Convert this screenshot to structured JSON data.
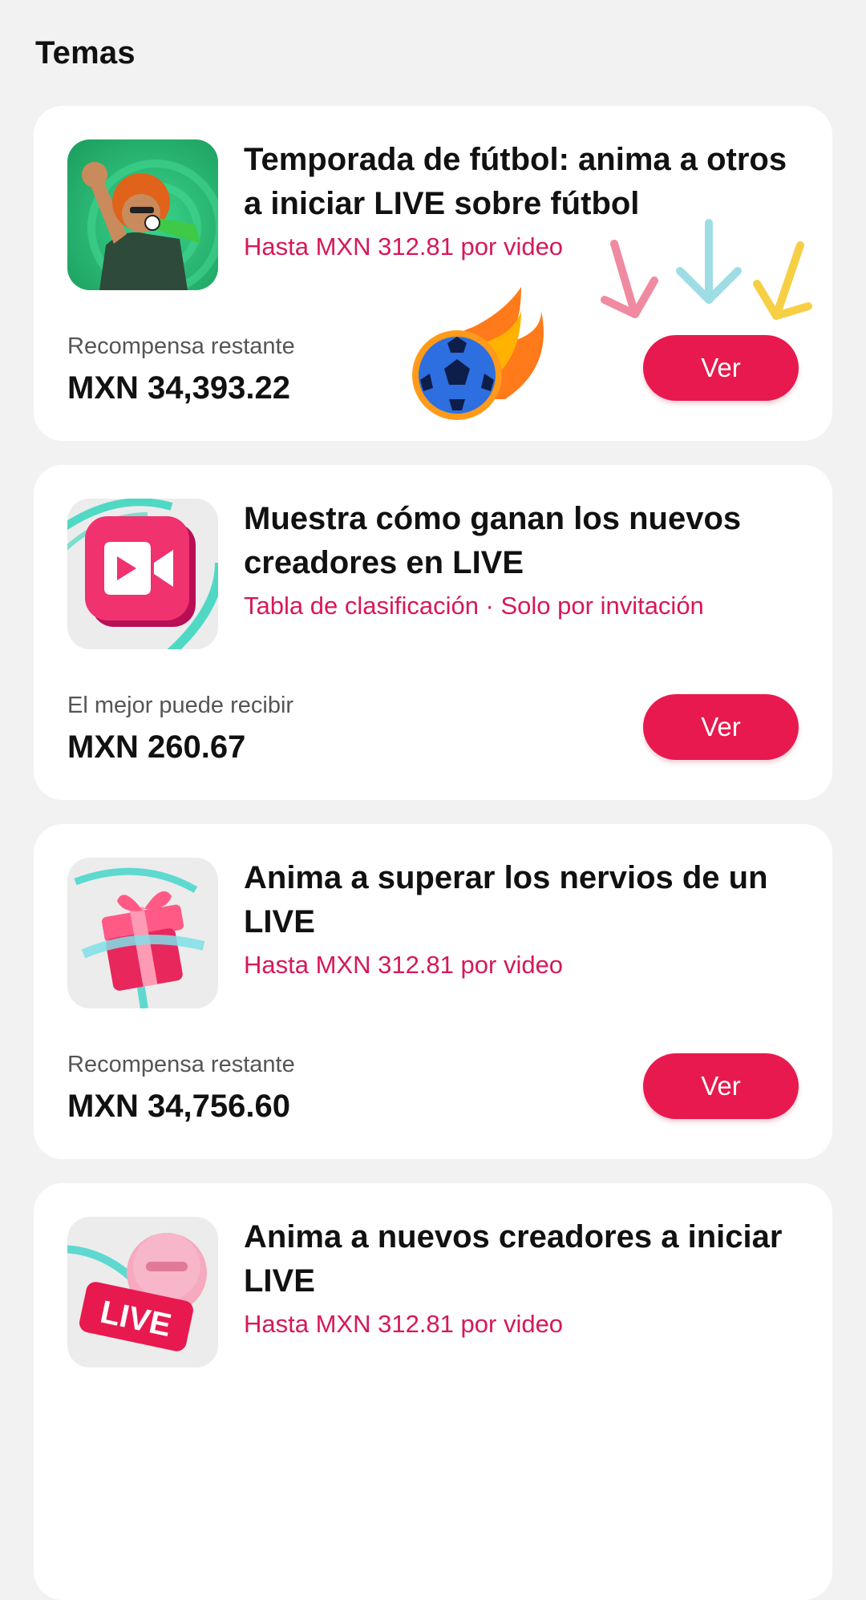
{
  "header": {
    "title": "Temas"
  },
  "cards": [
    {
      "title": "Temporada de fútbol: anima a otros a iniciar LIVE sobre fútbol",
      "subtitle": "Hasta MXN 312.81 por video",
      "reward_label": "Recompensa restante",
      "reward_value": "MXN 34,393.22",
      "button_label": "Ver",
      "icon": "football-fan-icon"
    },
    {
      "title": "Muestra cómo ganan los nuevos creadores en LIVE",
      "subtitle": "Tabla de clasificación · Solo por invitación",
      "reward_label": "El mejor puede recibir",
      "reward_value": "MXN 260.67",
      "button_label": "Ver",
      "icon": "video-camera-icon"
    },
    {
      "title": "Anima a superar los nervios de un LIVE",
      "subtitle": "Hasta MXN 312.81 por video",
      "reward_label": "Recompensa restante",
      "reward_value": "MXN 34,756.60",
      "button_label": "Ver",
      "icon": "gift-box-icon"
    },
    {
      "title": "Anima a nuevos creadores a iniciar LIVE",
      "subtitle": "Hasta MXN 312.81 por video",
      "icon": "live-badge-icon",
      "badge_text": "LIVE"
    }
  ],
  "decorations": {
    "sticker": "flaming-soccer-ball-icon",
    "arrows": [
      "pink-arrow-icon",
      "blue-arrow-icon",
      "yellow-arrow-icon"
    ]
  },
  "colors": {
    "accent": "#e8194e",
    "subtitle": "#d6185a",
    "background": "#f2f2f2",
    "card": "#ffffff"
  }
}
